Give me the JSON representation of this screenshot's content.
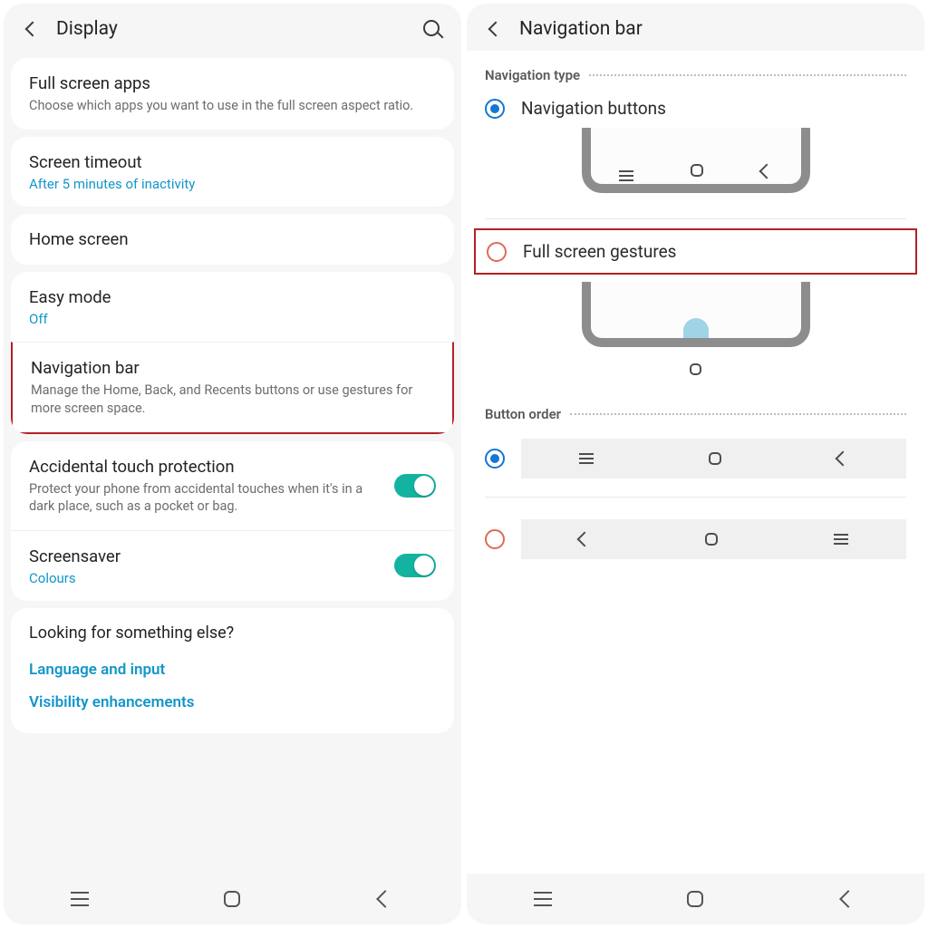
{
  "left": {
    "header": {
      "title": "Display"
    },
    "fullscreen": {
      "title": "Full screen apps",
      "sub": "Choose which apps you want to use in the full screen aspect ratio."
    },
    "timeout": {
      "title": "Screen timeout",
      "value": "After 5 minutes of inactivity"
    },
    "homescreen": {
      "title": "Home screen"
    },
    "easymode": {
      "title": "Easy mode",
      "value": "Off"
    },
    "navbar": {
      "title": "Navigation bar",
      "sub": "Manage the Home, Back, and Recents buttons or use gestures for more screen space."
    },
    "touchprotect": {
      "title": "Accidental touch protection",
      "sub": "Protect your phone from accidental touches when it's in a dark place, such as a pocket or bag."
    },
    "screensaver": {
      "title": "Screensaver",
      "value": "Colours"
    },
    "looking": {
      "title": "Looking for something else?",
      "link1": "Language and input",
      "link2": "Visibility enhancements"
    }
  },
  "right": {
    "header": {
      "title": "Navigation bar"
    },
    "navtype": {
      "section": "Navigation type",
      "opt1": "Navigation buttons",
      "opt2": "Full screen gestures"
    },
    "buttonorder": {
      "section": "Button order"
    }
  }
}
